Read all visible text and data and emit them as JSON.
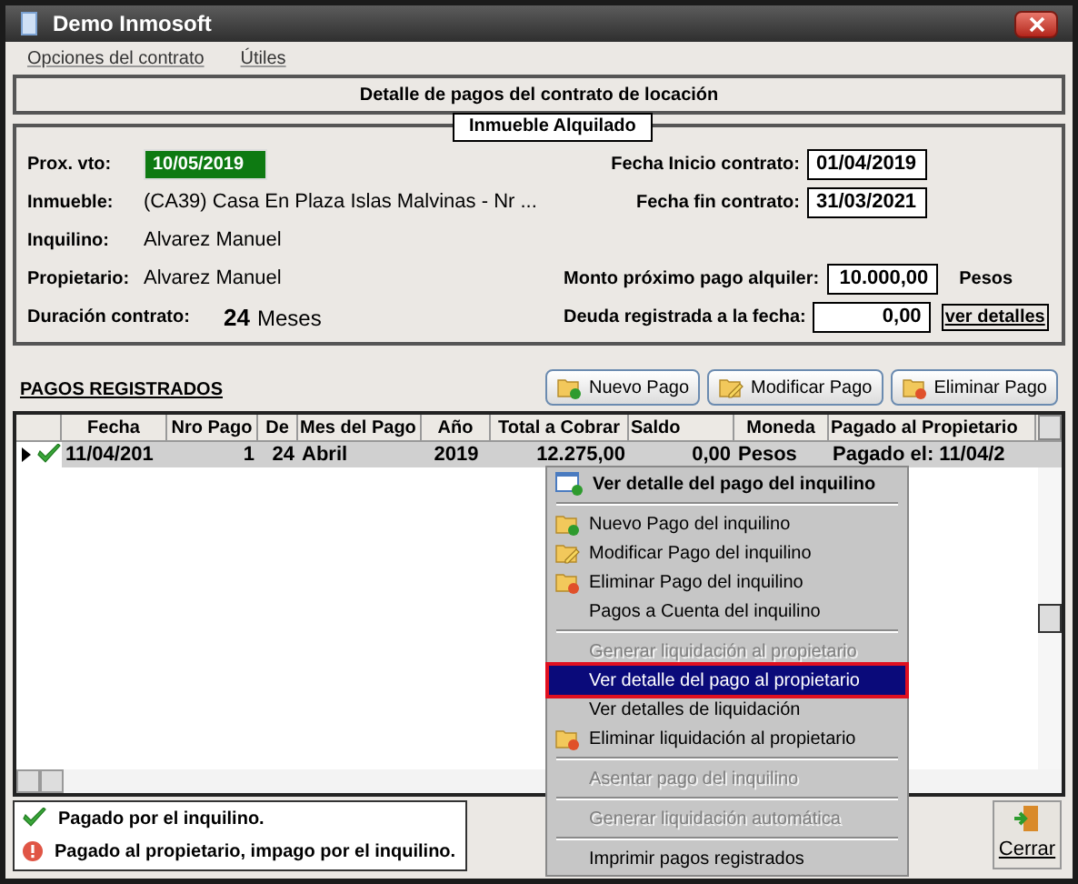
{
  "window": {
    "title": "Demo Inmosoft"
  },
  "menu": [
    "Opciones del contrato",
    "Útiles"
  ],
  "header": "Detalle de pagos del contrato de locación",
  "group_title": "Inmueble Alquilado",
  "info_rows": [
    {
      "left": {
        "label": "Prox. vto:",
        "value": "10/05/2019",
        "kind": "highlight"
      },
      "right": {
        "label": "Fecha Inicio contrato:",
        "value": "01/04/2019"
      }
    },
    {
      "left": {
        "label": "Inmueble:",
        "value": "(CA39) Casa En Plaza Islas Malvinas - Nr ...",
        "kind": "text"
      },
      "right": {
        "label": "Fecha fin contrato:",
        "value": "31/03/2021"
      }
    },
    {
      "left": {
        "label": "Inquilino:",
        "value": "Alvarez Manuel",
        "kind": "text"
      }
    },
    {
      "left": {
        "label": "Propietario:",
        "value": "Alvarez Manuel",
        "kind": "text"
      },
      "right": {
        "label": "Monto próximo pago alquiler:",
        "value": "10.000,00",
        "suffix": "Pesos"
      }
    },
    {
      "left": {
        "label": "Duración contrato:",
        "value": "24",
        "unit": "Meses",
        "kind": "number"
      },
      "right": {
        "label": "Deuda registrada a la fecha:",
        "value": "0,00",
        "action": "ver detalles"
      }
    }
  ],
  "section_title": "PAGOS REGISTRADOS",
  "buttons": [
    "Nuevo Pago",
    "Modificar Pago",
    "Eliminar Pago"
  ],
  "table": {
    "columns": [
      "Fecha",
      "Nro Pago",
      "De",
      "Mes del Pago",
      "Año",
      "Total a Cobrar",
      "Saldo",
      "Moneda",
      "Pagado al Propietario"
    ],
    "rows": [
      {
        "selected": true,
        "paid": true,
        "cells": [
          "11/04/201",
          "1",
          "24",
          "Abril",
          "2019",
          "12.275,00",
          "0,00",
          "Pesos",
          "Pagado el: 11/04/2"
        ]
      }
    ]
  },
  "legend": [
    "Pagado por el inquilino.",
    "Pagado al propietario, impago por el inquilino."
  ],
  "close_button": "Cerrar",
  "context_menu": [
    {
      "kind": "default",
      "label": "Ver detalle del pago del inquilino",
      "disabled": false,
      "selected": false
    },
    {
      "kind": "separator"
    },
    {
      "kind": "item",
      "label": "Nuevo Pago del inquilino",
      "disabled": false,
      "selected": false
    },
    {
      "kind": "item",
      "label": "Modificar Pago del inquilino",
      "disabled": false,
      "selected": false
    },
    {
      "kind": "item",
      "label": "Eliminar Pago del inquilino",
      "disabled": false,
      "selected": false
    },
    {
      "kind": "item",
      "label": "Pagos a Cuenta del inquilino",
      "disabled": false,
      "selected": false
    },
    {
      "kind": "separator"
    },
    {
      "kind": "item",
      "label": "Generar liquidación al propietario",
      "disabled": true,
      "selected": false
    },
    {
      "kind": "item",
      "label": "Ver detalle del pago al propietario",
      "disabled": false,
      "selected": true
    },
    {
      "kind": "item",
      "label": "Ver detalles de liquidación",
      "disabled": false,
      "selected": false
    },
    {
      "kind": "item",
      "label": "Eliminar liquidación al propietario",
      "disabled": false,
      "selected": false
    },
    {
      "kind": "separator"
    },
    {
      "kind": "item",
      "label": "Asentar pago del inquilino",
      "disabled": true,
      "selected": false
    },
    {
      "kind": "separator"
    },
    {
      "kind": "item",
      "label": "Generar liquidación automática",
      "disabled": true,
      "selected": false
    },
    {
      "kind": "separator"
    },
    {
      "kind": "item",
      "label": "Imprimir pagos registrados",
      "disabled": false,
      "selected": false
    }
  ]
}
